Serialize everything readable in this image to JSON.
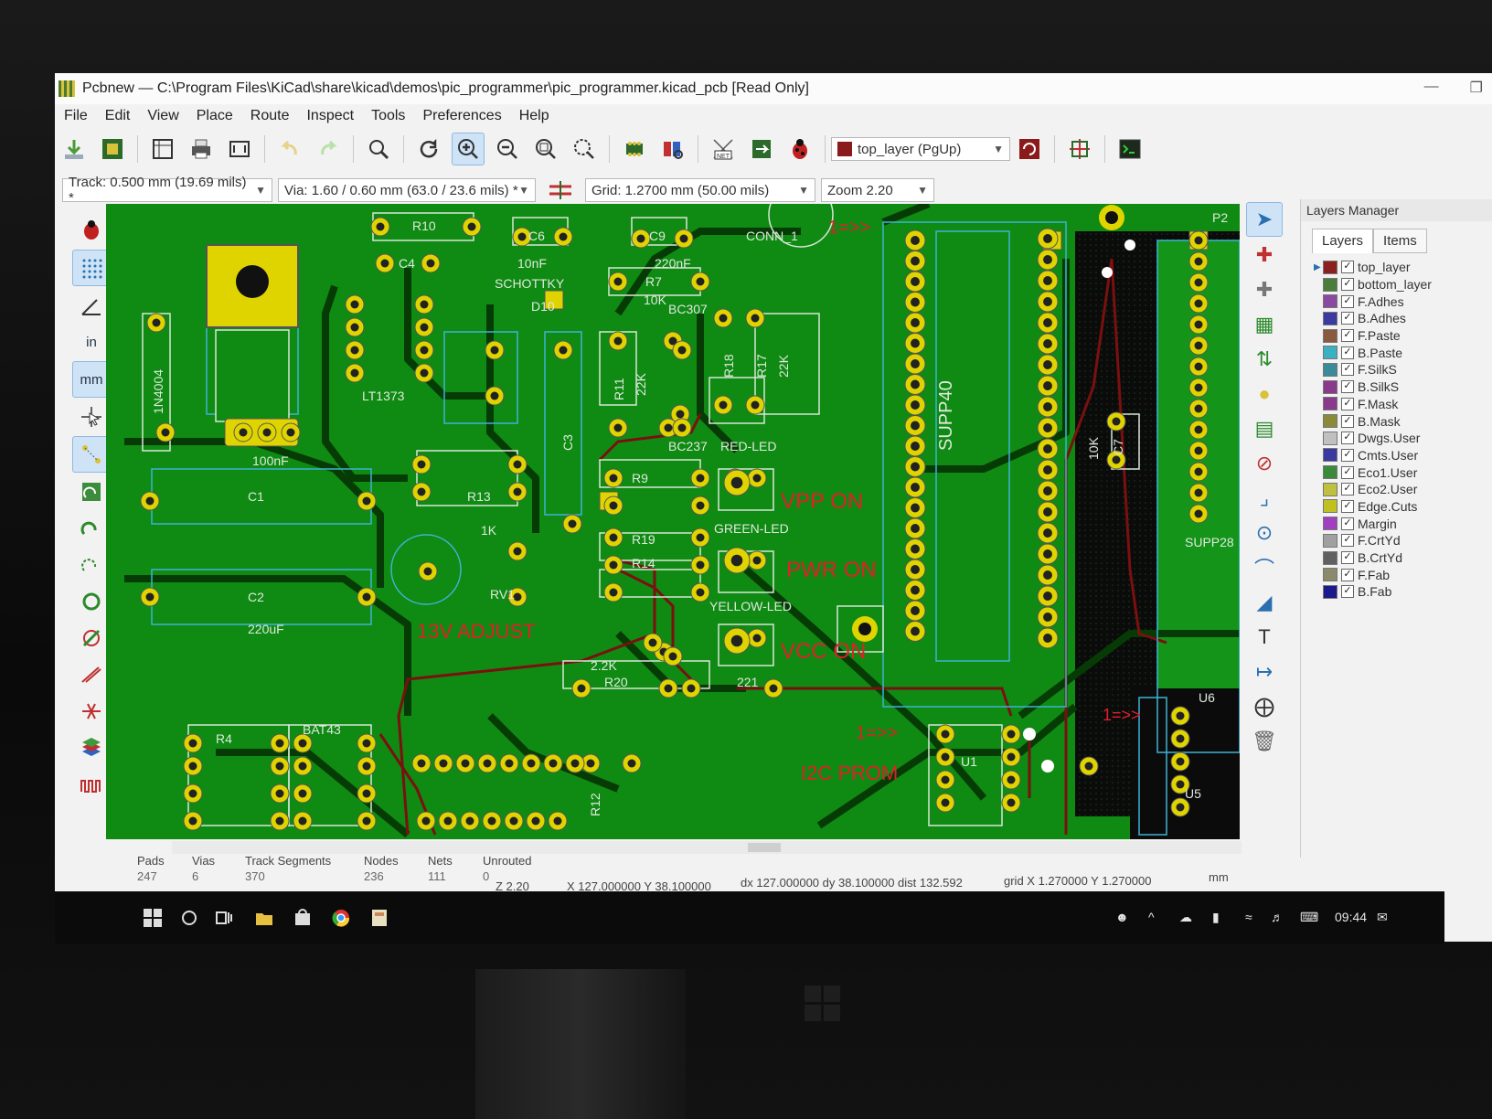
{
  "window": {
    "title": "Pcbnew — C:\\Program Files\\KiCad\\share\\kicad\\demos\\pic_programmer\\pic_programmer.kicad_pcb [Read Only]"
  },
  "menu": [
    "File",
    "Edit",
    "View",
    "Place",
    "Route",
    "Inspect",
    "Tools",
    "Preferences",
    "Help"
  ],
  "toolbar": {
    "layer_select": "top_layer (PgUp)",
    "layer_color": "#8b1a1a"
  },
  "toolbar2": {
    "track": "Track: 0.500 mm (19.69 mils) *",
    "via": "Via: 1.60 / 0.60 mm (63.0 / 23.6 mils) *",
    "grid": "Grid: 1.2700 mm (50.00 mils)",
    "zoom": "Zoom 2.20"
  },
  "left_tools": [
    "in",
    "mm"
  ],
  "pcb": {
    "labels": {
      "vpp": "VPP ON",
      "pwr": "PWR ON",
      "vcc": "VCC ON",
      "adjust": "13V ADJUST",
      "i2c": "I2C PROM",
      "conn": "CONN_1",
      "one_a": "1=>>",
      "one_b": "1=>>",
      "one_c": "1=>>",
      "supp40": "SUPP40",
      "red_led": "RED-LED",
      "green_led": "GREEN-LED",
      "yellow_led": "YELLOW-LED",
      "schottky": "SCHOTTKY",
      "r10": "R10",
      "c6": "C6",
      "c9": "C9",
      "r7": "R7",
      "c4": "C4",
      "n10nf": "10nF",
      "n220nf": "220nF",
      "lt1373": "LT1373",
      "n1n4004": "1N4004",
      "n100nf": "100nF",
      "c1": "C1",
      "c2": "C2",
      "n220uf": "220uF",
      "r11": "R11",
      "n22k_a": "22K",
      "r18": "R18",
      "r17": "R17",
      "n22k_b": "22K",
      "r13": "R13",
      "n1k": "1K",
      "rv1": "RV1",
      "r20": "R20",
      "r19": "R19",
      "r14": "R14",
      "r9": "R9",
      "bat43": "BAT43",
      "r4": "R4",
      "r12": "R12",
      "u1": "U1",
      "u5": "U5",
      "u6": "U6",
      "p2": "P2",
      "d10": "D10",
      "n10k": "10K",
      "n10k2": "10K",
      "c3": "C3",
      "c7": "C7",
      "supp28": "SUPP28",
      "bc237": "BC237",
      "bc307": "BC307",
      "n2_2k": "2.2K",
      "n221": "221"
    }
  },
  "layers_manager": {
    "title": "Layers Manager",
    "tabs": [
      "Layers",
      "Items"
    ],
    "layers": [
      {
        "name": "top_layer",
        "color": "#8b2020"
      },
      {
        "name": "bottom_layer",
        "color": "#4a7d3a"
      },
      {
        "name": "F.Adhes",
        "color": "#8a4aa0"
      },
      {
        "name": "B.Adhes",
        "color": "#3a3aa0"
      },
      {
        "name": "F.Paste",
        "color": "#8a5a40"
      },
      {
        "name": "B.Paste",
        "color": "#3ab0c0"
      },
      {
        "name": "F.SilkS",
        "color": "#3a8a9a"
      },
      {
        "name": "B.SilkS",
        "color": "#8a3a8a"
      },
      {
        "name": "F.Mask",
        "color": "#8a3a8a"
      },
      {
        "name": "B.Mask",
        "color": "#8a8a3a"
      },
      {
        "name": "Dwgs.User",
        "color": "#c0c0c0"
      },
      {
        "name": "Cmts.User",
        "color": "#3a3aa0"
      },
      {
        "name": "Eco1.User",
        "color": "#3a8a3a"
      },
      {
        "name": "Eco2.User",
        "color": "#c0c040"
      },
      {
        "name": "Edge.Cuts",
        "color": "#c0c020"
      },
      {
        "name": "Margin",
        "color": "#a040c0"
      },
      {
        "name": "F.CrtYd",
        "color": "#a0a0a0"
      },
      {
        "name": "B.CrtYd",
        "color": "#606060"
      },
      {
        "name": "F.Fab",
        "color": "#8a8a6a"
      },
      {
        "name": "B.Fab",
        "color": "#1a1a8a"
      }
    ]
  },
  "status": {
    "pads_label": "Pads",
    "pads": "247",
    "vias_label": "Vias",
    "vias": "6",
    "tracks_label": "Track Segments",
    "tracks": "370",
    "nodes_label": "Nodes",
    "nodes": "236",
    "nets_label": "Nets",
    "nets": "111",
    "unrouted_label": "Unrouted",
    "unrouted": "0",
    "zoom": "Z 2.20",
    "xy": "X 127.000000  Y 38.100000",
    "delta": "dx 127.000000  dy 38.100000  dist 132.592",
    "grid": "grid X 1.270000  Y 1.270000",
    "units": "mm"
  },
  "taskbar": {
    "time": "09:44"
  }
}
